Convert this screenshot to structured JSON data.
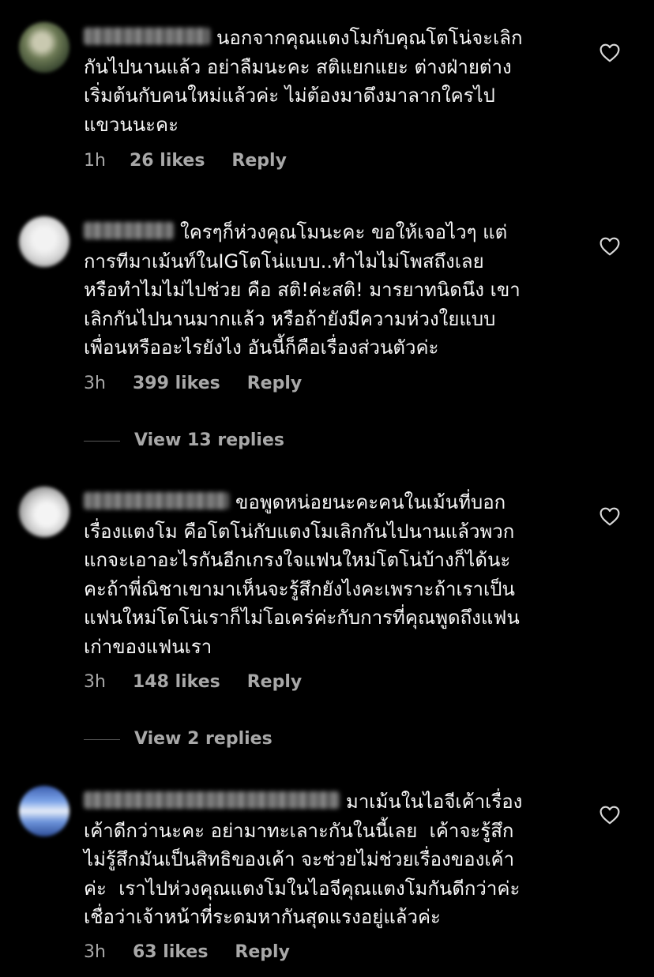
{
  "comments": [
    {
      "text": "นอกจากคุณแตงโมกับคุณโตโน่จะเลิก\nกันไปนานแล้ว อย่าลืมนะคะ สติแยกแยะ ต่างฝ่ายต่าง\nเริ่มต้นกับคนใหม่แล้วค่ะ ไม่ต้องมาดึงมาลากใครไป\nแขวนนะคะ",
      "time": "1h",
      "likes": "26 likes",
      "reply": "Reply",
      "view_replies": ""
    },
    {
      "text": "ใครๆก็ห่วงคุณโมนะคะ ขอให้เจอไวๆ แต่\nการทีมาเม้นท์ในIGโตโน่แบบ..ทำไมไม่โพสถึงเลย\nหรือทำไมไม่ไปช่วย คือ สติ!ค่ะสติ! มารยาทนิดนึง เขา\nเลิกกันไปนานมากแล้ว หรือถ้ายังมีความห่วงใยแบบ\nเพื่อนหรืออะไรยังไง อันนี้ก็คือเรื่องส่วนตัวค่ะ",
      "time": "3h",
      "likes": "399 likes",
      "reply": "Reply",
      "view_replies": "View 13 replies"
    },
    {
      "text": "ขอพูดหน่อยนะคะคนในเม้นที่บอก\nเรื่องแตงโม คือโตโน่กับแตงโมเลิกกันไปนานแล้วพวก\nแกจะเอาอะไรกันอีกเกรงใจแฟนใหม่โตโน่บ้างก็ได้นะ\nคะถ้าพี่ณิชาเขามาเห็นจะรู้สึกยังไงคะเพราะถ้าเราเป็น\nแฟนใหม่โตโน่เราก็ไม่โอเคร่ค่ะกับการที่คุณพูดถึงแฟน\nเก่าของแฟนเรา",
      "time": "3h",
      "likes": "148 likes",
      "reply": "Reply",
      "view_replies": "View 2 replies"
    },
    {
      "text": "มาเม้นในไอจีเค้าเรื่อง\nเค้าดีกว่านะคะ อย่ามาทะเลาะกันในนี้เลย  เค้าจะรู้สึก\nไม่รู้สึกมันเป็นสิทธิของเค้า จะช่วยไม่ช่วยเรื่องของเค้า\nค่ะ  เราไปห่วงคุณแตงโมในไอจีคุณแตงโมกันดีกว่าค่ะ\nเชื่อว่าเจ้าหน้าที่ระดมหากันสุดแรงอยู่แล้วค่ะ",
      "time": "3h",
      "likes": "63 likes",
      "reply": "Reply",
      "view_replies": ""
    }
  ],
  "colors": {
    "background": "#000000",
    "text": "#f5f5f5",
    "meta": "#a8a8a8",
    "divider": "#5a5a5a"
  },
  "icons": {
    "like": "heart-icon",
    "avatar": "avatar-blurred",
    "username": "username-blurred"
  }
}
